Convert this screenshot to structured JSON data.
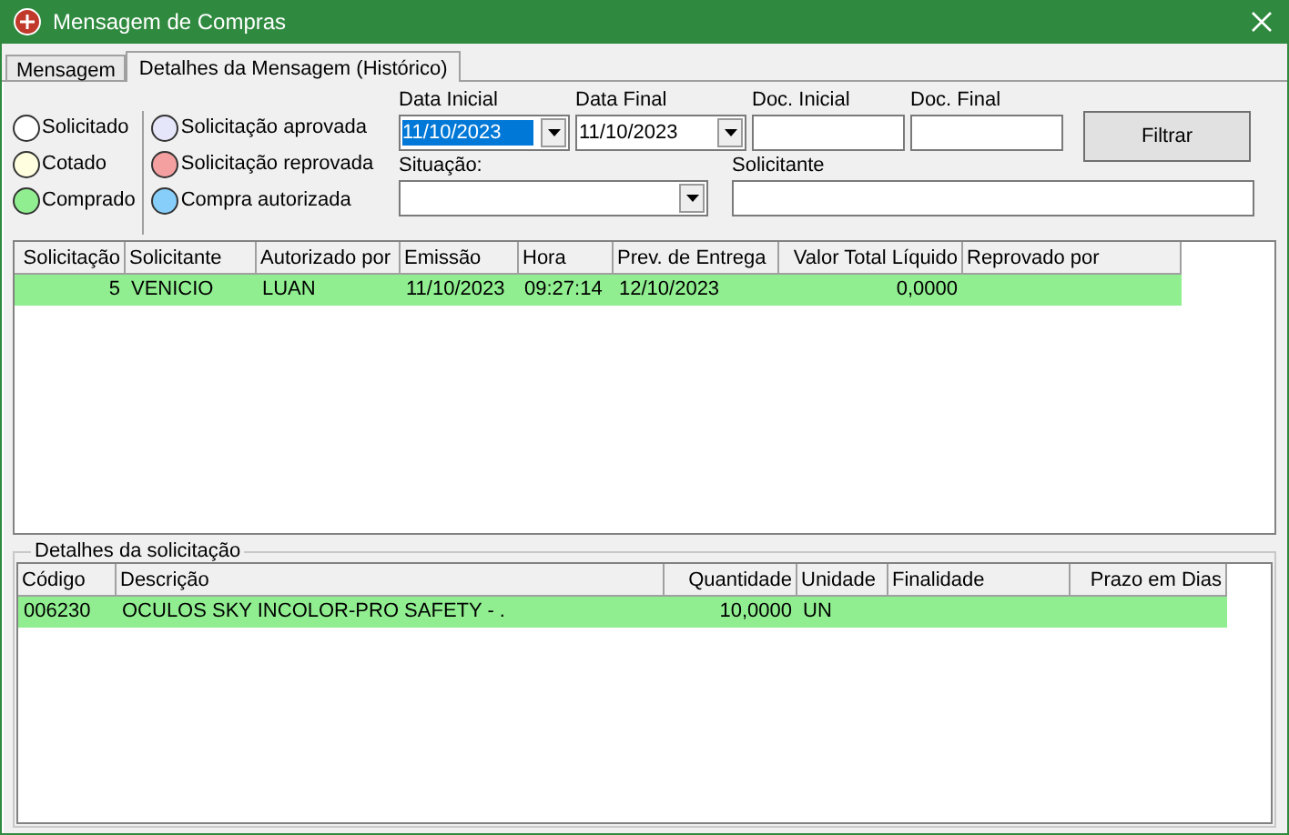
{
  "window": {
    "title": "Mensagem de Compras"
  },
  "tabs": [
    {
      "label": "Mensagem",
      "selected": false
    },
    {
      "label": "Detalhes da Mensagem (Histórico)",
      "selected": true
    }
  ],
  "legend": [
    [
      {
        "label": "Solicitado",
        "color": "#ffffff"
      },
      {
        "label": "Cotado",
        "color": "#ffffe0"
      },
      {
        "label": "Comprado",
        "color": "#90ee90"
      }
    ],
    [
      {
        "label": "Solicitação aprovada",
        "color": "#e6e6fa"
      },
      {
        "label": "Solicitação reprovada",
        "color": "#f4a0a0"
      },
      {
        "label": "Compra autorizada",
        "color": "#87cefa"
      }
    ]
  ],
  "filters": {
    "data_inicial": {
      "label": "Data Inicial",
      "value": "11/10/2023",
      "selected": true
    },
    "data_final": {
      "label": "Data Final",
      "value": "11/10/2023",
      "selected": false
    },
    "doc_inicial": {
      "label": "Doc. Inicial"
    },
    "doc_final": {
      "label": "Doc. Final"
    },
    "situacao": {
      "label": "Situação:"
    },
    "solicitante": {
      "label": "Solicitante"
    },
    "button": "Filtrar"
  },
  "table": {
    "columns": [
      {
        "label": "Solicitação",
        "numeric": true
      },
      {
        "label": "Solicitante",
        "numeric": false
      },
      {
        "label": "Autorizado por",
        "numeric": false
      },
      {
        "label": "Emissão",
        "numeric": false
      },
      {
        "label": "Hora",
        "numeric": false
      },
      {
        "label": "Prev. de Entrega",
        "numeric": false
      },
      {
        "label": "Valor Total Líquido",
        "numeric": true
      },
      {
        "label": "Reprovado por",
        "numeric": false
      }
    ],
    "rows": [
      {
        "color": "#90ee90",
        "cells": [
          "5",
          "VENICIO",
          "LUAN",
          "11/10/2023",
          "09:27:14",
          "12/10/2023",
          "0,0000",
          ""
        ]
      }
    ]
  },
  "details": {
    "title": "Detalhes da solicitação",
    "columns": [
      {
        "label": "Código",
        "numeric": false
      },
      {
        "label": "Descrição",
        "numeric": false
      },
      {
        "label": "Quantidade",
        "numeric": true
      },
      {
        "label": "Unidade",
        "numeric": false
      },
      {
        "label": "Finalidade",
        "numeric": false
      },
      {
        "label": "Prazo em Dias",
        "numeric": true
      }
    ],
    "rows": [
      {
        "color": "#90ee90",
        "cells": [
          "006230",
          "OCULOS SKY INCOLOR-PRO SAFETY - .",
          "10,0000",
          "UN",
          "",
          ""
        ]
      }
    ]
  }
}
